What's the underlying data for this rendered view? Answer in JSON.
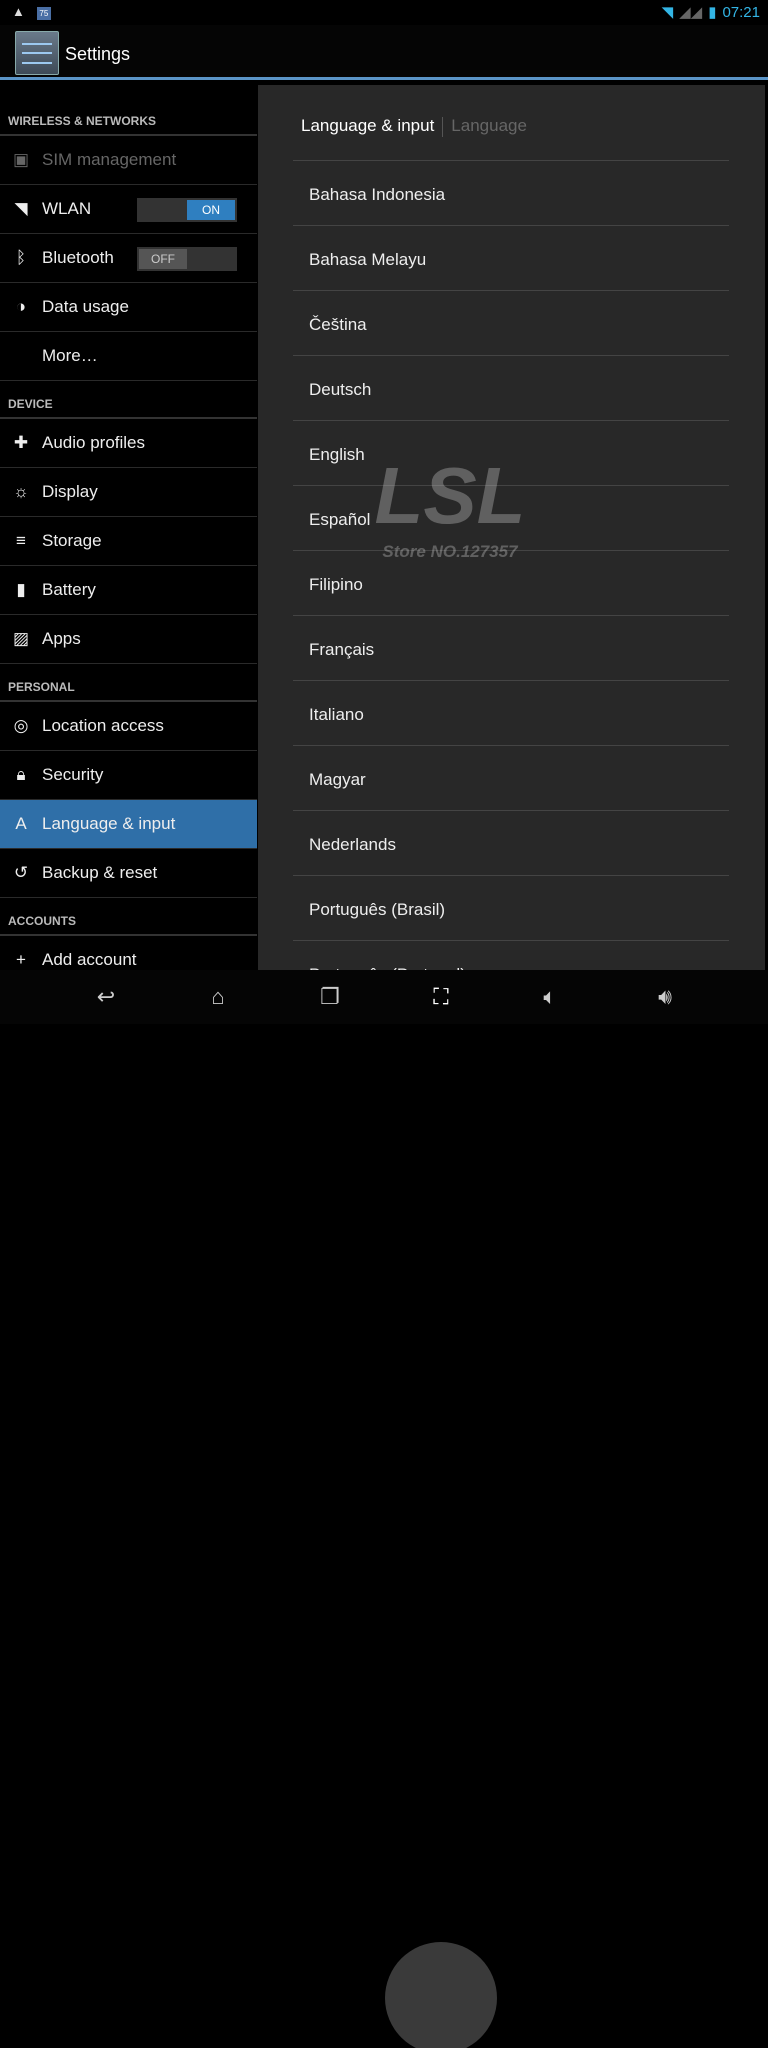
{
  "status": {
    "time": "07:21",
    "calendar_day": "75"
  },
  "app": {
    "title": "Settings"
  },
  "sidebar": {
    "sections": [
      {
        "header": "WIRELESS & NETWORKS",
        "items": [
          {
            "label": "SIM management",
            "icon": "sim-icon",
            "disabled": true
          },
          {
            "label": "WLAN",
            "icon": "wifi-icon",
            "toggle": "ON"
          },
          {
            "label": "Bluetooth",
            "icon": "bluetooth-icon",
            "toggle": "OFF"
          },
          {
            "label": "Data usage",
            "icon": "data-usage-icon"
          },
          {
            "label": "More…",
            "icon": ""
          }
        ]
      },
      {
        "header": "DEVICE",
        "items": [
          {
            "label": "Audio profiles",
            "icon": "audio-icon"
          },
          {
            "label": "Display",
            "icon": "display-icon"
          },
          {
            "label": "Storage",
            "icon": "storage-icon"
          },
          {
            "label": "Battery",
            "icon": "battery-icon"
          },
          {
            "label": "Apps",
            "icon": "apps-icon"
          }
        ]
      },
      {
        "header": "PERSONAL",
        "items": [
          {
            "label": "Location access",
            "icon": "location-icon"
          },
          {
            "label": "Security",
            "icon": "lock-icon"
          },
          {
            "label": "Language & input",
            "icon": "language-icon",
            "selected": true
          },
          {
            "label": "Backup & reset",
            "icon": "backup-icon"
          }
        ]
      },
      {
        "header": "ACCOUNTS",
        "items": [
          {
            "label": "Add account",
            "icon": "add-icon"
          }
        ]
      }
    ]
  },
  "main": {
    "breadcrumb": "Language & input",
    "sub": "Language",
    "languages": [
      "Bahasa Indonesia",
      "Bahasa Melayu",
      "Čeština",
      "Deutsch",
      "English",
      "Español",
      "Filipino",
      "Français",
      "Italiano",
      "Magyar",
      "Nederlands",
      "Português (Brasil)",
      "Português (Portugal)"
    ]
  },
  "watermark": {
    "logo": "LSL",
    "store": "Store NO.127357"
  },
  "colors": {
    "accent": "#33b5e5",
    "selected": "#2f6fa8"
  }
}
